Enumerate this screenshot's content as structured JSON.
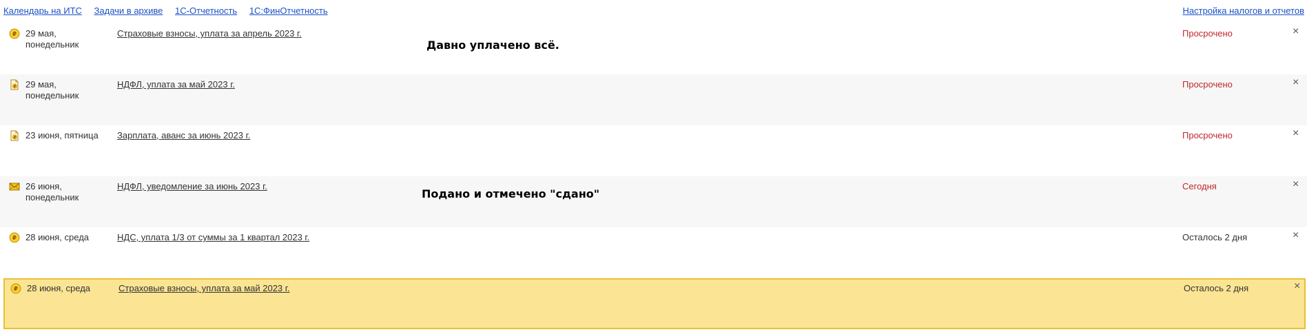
{
  "topnav": {
    "links": [
      {
        "label": "Календарь на ИТС"
      },
      {
        "label": "Задачи в архиве"
      },
      {
        "label": "1С-Отчетность"
      },
      {
        "label": "1С:ФинОтчетность"
      }
    ],
    "settings_label": "Настройка налогов и отчетов"
  },
  "tasks": [
    {
      "icon": "coin-icon",
      "date": "29 мая, понедельник",
      "title": "Страховые взносы, уплата за апрель 2023 г.",
      "status": "Просрочено",
      "status_kind": "overdue"
    },
    {
      "icon": "payment-document-icon",
      "date": "29 мая, понедельник",
      "title": "НДФЛ, уплата за май 2023 г.",
      "status": "Просрочено",
      "status_kind": "overdue"
    },
    {
      "icon": "payment-document-icon",
      "date": "23 июня, пятница",
      "title": "Зарплата, аванс за июнь 2023 г.",
      "status": "Просрочено",
      "status_kind": "overdue"
    },
    {
      "icon": "envelope-icon",
      "date": "26 июня, понедельник",
      "title": "НДФЛ, уведомление за июнь 2023 г.",
      "status": "Сегодня",
      "status_kind": "today"
    },
    {
      "icon": "coin-icon",
      "date": "28 июня, среда",
      "title": "НДС, уплата 1/3 от суммы за 1 квартал 2023 г.",
      "status": "Осталось 2 дня",
      "status_kind": "normal"
    },
    {
      "icon": "coin-icon",
      "date": "28 июня, среда",
      "title": "Страховые взносы, уплата за май 2023 г.",
      "status": "Осталось 2 дня",
      "status_kind": "normal",
      "selected": true
    }
  ],
  "close_glyph": "×",
  "annotations": {
    "first": "Давно уплачено всё.",
    "second": "Подано и отмечено \"сдано\""
  },
  "colors": {
    "link": "#1b52c6",
    "overdue": "#c0262c",
    "selected_bg": "#fbe494",
    "selected_border": "#e9c031",
    "alt_row_bg": "#f7f7f7"
  }
}
